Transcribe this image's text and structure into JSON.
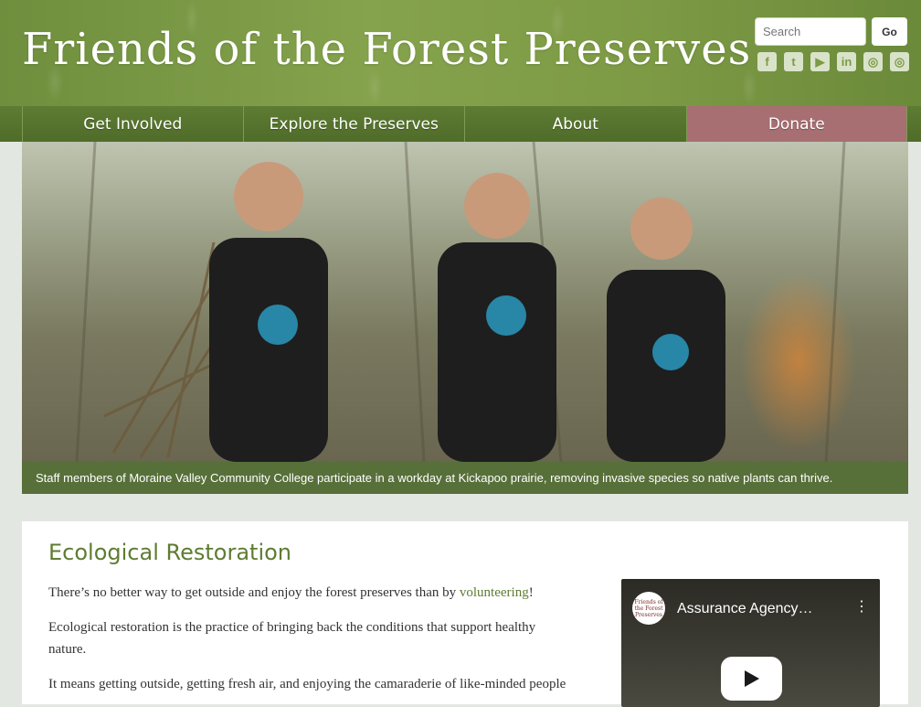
{
  "header": {
    "site_title": "Friends of the Forest Preserves",
    "search_placeholder": "Search",
    "go_label": "Go",
    "social": [
      {
        "icon": "facebook-icon",
        "glyph": "f"
      },
      {
        "icon": "twitter-icon",
        "glyph": "t"
      },
      {
        "icon": "youtube-icon",
        "glyph": "▶"
      },
      {
        "icon": "linkedin-icon",
        "glyph": "in"
      },
      {
        "icon": "instagram-icon",
        "glyph": "◎"
      },
      {
        "icon": "instagram-icon",
        "glyph": "◎"
      }
    ]
  },
  "nav": {
    "items": [
      {
        "label": "Get Involved"
      },
      {
        "label": "Explore the Preserves"
      },
      {
        "label": "About"
      },
      {
        "label": "Donate"
      }
    ]
  },
  "hero": {
    "caption": "Staff members of Moraine Valley Community College participate in a workday at Kickapoo prairie, removing invasive species so native plants can thrive."
  },
  "content": {
    "heading": "Ecological Restoration",
    "p1_before": "There’s no better way to get outside and enjoy the forest preserves than by ",
    "p1_link": "volunteering",
    "p1_after": "!",
    "p2": "Ecological restoration is the practice of bringing back the conditions that support healthy nature.",
    "p3": "It means getting outside, getting fresh air, and enjoying the camaraderie of like-minded people"
  },
  "video": {
    "title": "Assurance Agency…",
    "channel_logo_text": "Friends of the Forest Preserves"
  },
  "colors": {
    "header_green": "#7d9a45",
    "nav_green": "#4f6c2a",
    "donate": "#a76f72",
    "link_green": "#5e7c32"
  }
}
